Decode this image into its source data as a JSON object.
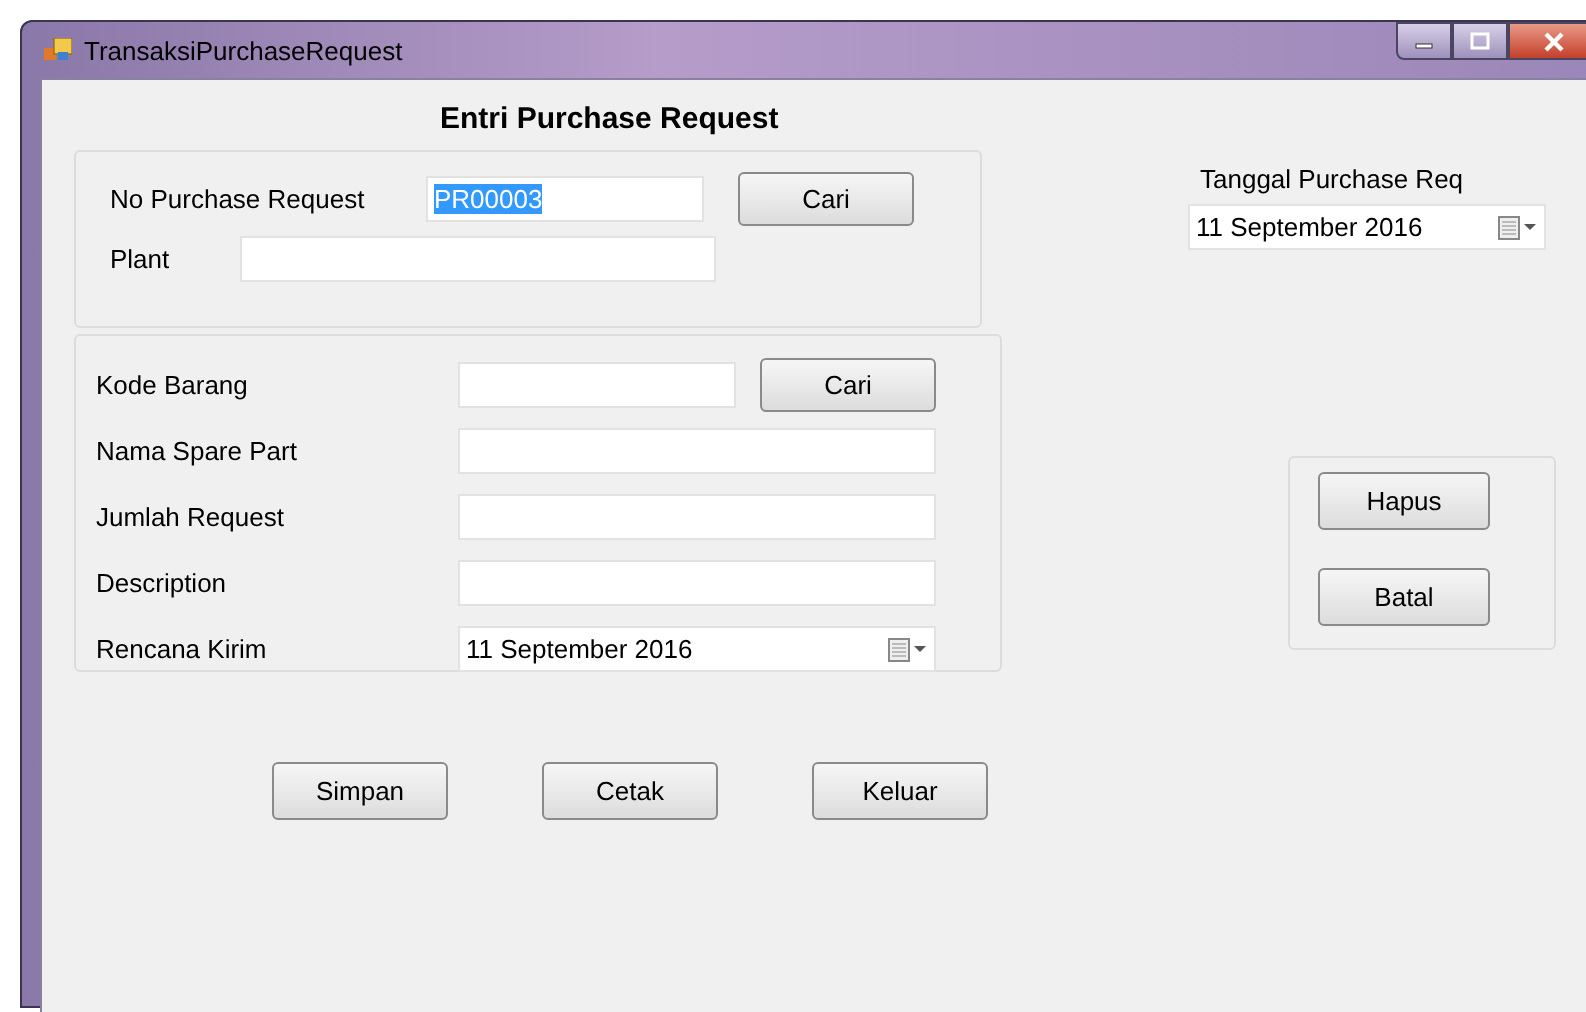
{
  "window": {
    "title": "TransaksiPurchaseRequest"
  },
  "heading": "Entri Purchase Request",
  "header_group": {
    "fields": [
      {
        "label": "No Purchase Request",
        "value": "PR00003",
        "text_selected": true,
        "button": "Cari"
      },
      {
        "label": "Plant"
      }
    ]
  },
  "item_group": {
    "fields": [
      {
        "kind": "text",
        "label": "Kode Barang",
        "button": "Cari"
      },
      {
        "kind": "text",
        "label": "Nama Spare Part"
      },
      {
        "kind": "text",
        "label": "Jumlah Request"
      },
      {
        "kind": "text",
        "label": "Description"
      },
      {
        "kind": "date",
        "label": "Rencana Kirim",
        "value": "11 September 2016"
      }
    ]
  },
  "date_field": {
    "label": "Tanggal Purchase Req",
    "value": "11 September 2016"
  },
  "side_buttons": [
    "Hapus",
    "Batal"
  ],
  "bottom_buttons": [
    "Simpan",
    "Cetak",
    "Keluar"
  ]
}
